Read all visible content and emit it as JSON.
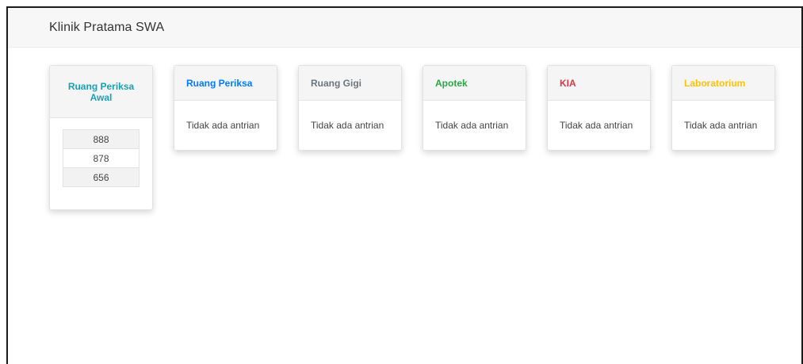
{
  "navbar": {
    "brand": "Klinik Pratama SWA"
  },
  "rooms": [
    {
      "title": "Ruang Periksa Awal",
      "color": "#17a2b8",
      "queue": [
        "888",
        "878",
        "656"
      ]
    },
    {
      "title": "Ruang Periksa",
      "color": "#007bff",
      "empty_text": "Tidak ada antrian"
    },
    {
      "title": "Ruang Gigi",
      "color": "#6c757d",
      "empty_text": "Tidak ada antrian"
    },
    {
      "title": "Apotek",
      "color": "#28a745",
      "empty_text": "Tidak ada antrian"
    },
    {
      "title": "KIA",
      "color": "#dc3545",
      "empty_text": "Tidak ada antrian"
    },
    {
      "title": "Laboratorium",
      "color": "#ffc107",
      "empty_text": "Tidak ada antrian"
    }
  ]
}
